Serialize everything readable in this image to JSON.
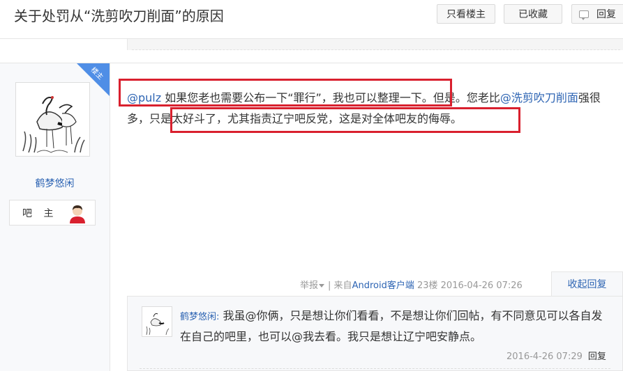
{
  "header": {
    "title": "关于处罚从“洗剪吹刀削面”的原因",
    "only_op_label": "只看楼主",
    "favorited_label": "已收藏",
    "reply_label": "回复"
  },
  "author": {
    "badge": "楼主",
    "name": "鹤梦悠闲",
    "role": "吧 主"
  },
  "post": {
    "mention1": "@pulz",
    "seg1": " 如果您老也需要公布一下“罪行”，我也可以整理一下。",
    "seg2": "但是。您老比",
    "mention2": "@洗剪吹刀削面",
    "seg3": "强很多，",
    "seg4": "只是太好斗了，尤其指责辽宁吧反党，这是对全体吧友的侮辱。"
  },
  "tail": {
    "report": "举报",
    "sep": "|",
    "from_prefix": "来自",
    "client": "Android客户端",
    "floor": "23楼",
    "time": "2016-04-26 07:26",
    "collapse_reply": "收起回复"
  },
  "reply": {
    "author": "鹤梦悠闲:",
    "content": "我虽@你俩，只是想让你们看看，不是想让你们回帖，有不同意见可以各自发在自己的吧里，也可以@我去看。我只是想让辽宁吧安静点。",
    "time": "2016-4-26 07:29",
    "reply_link": "回复"
  },
  "colors": {
    "link": "#2d64b3",
    "highlight_border": "#d9202e",
    "badge": "#4f8ee6"
  }
}
